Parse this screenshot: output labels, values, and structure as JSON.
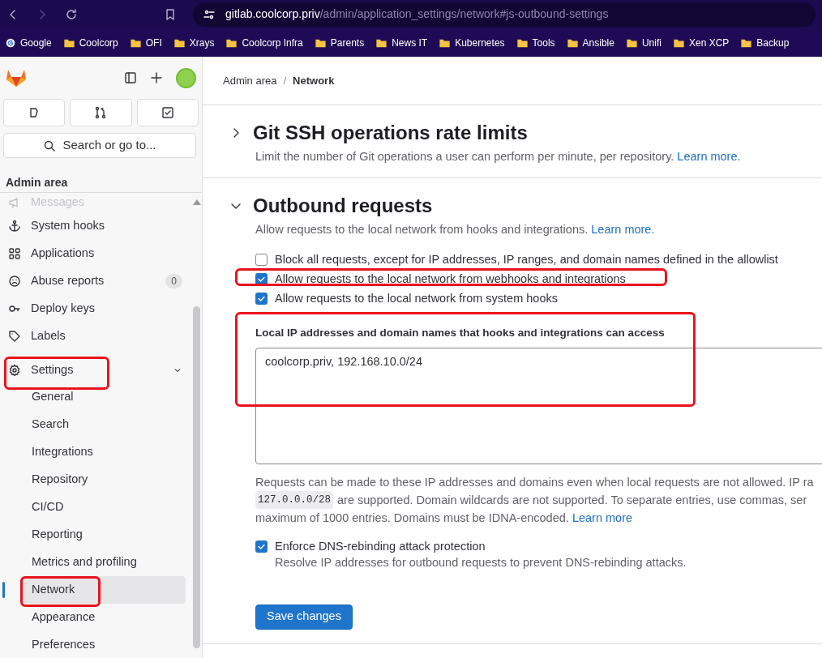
{
  "browser": {
    "url_host": "gitlab.coolcorp.priv",
    "url_path": "/admin/application_settings/network#js-outbound-settings",
    "bookmarks": [
      {
        "label": "Google",
        "kind": "site"
      },
      {
        "label": "Coolcorp",
        "kind": "folder"
      },
      {
        "label": "OFI",
        "kind": "folder"
      },
      {
        "label": "Xrays",
        "kind": "folder"
      },
      {
        "label": "Coolcorp Infra",
        "kind": "folder"
      },
      {
        "label": "Parents",
        "kind": "folder"
      },
      {
        "label": "News IT",
        "kind": "folder"
      },
      {
        "label": "Kubernetes",
        "kind": "folder"
      },
      {
        "label": "Tools",
        "kind": "folder"
      },
      {
        "label": "Ansible",
        "kind": "folder"
      },
      {
        "label": "Unifi",
        "kind": "folder"
      },
      {
        "label": "Xen XCP",
        "kind": "folder"
      },
      {
        "label": "Backup",
        "kind": "folder"
      }
    ]
  },
  "sidebar": {
    "search_placeholder": "Search or go to...",
    "section_title": "Admin area",
    "items": [
      {
        "label": "Messages",
        "faded": true,
        "selected": false
      },
      {
        "label": "System hooks",
        "faded": false,
        "selected": false
      },
      {
        "label": "Applications",
        "faded": false,
        "selected": false
      },
      {
        "label": "Abuse reports",
        "faded": false,
        "selected": false,
        "badge": "0"
      },
      {
        "label": "Deploy keys",
        "faded": false,
        "selected": false
      },
      {
        "label": "Labels",
        "faded": false,
        "selected": false
      },
      {
        "label": "Settings",
        "faded": false,
        "selected": false,
        "expanded": true,
        "children": [
          {
            "label": "General",
            "selected": false
          },
          {
            "label": "Search",
            "selected": false
          },
          {
            "label": "Integrations",
            "selected": false
          },
          {
            "label": "Repository",
            "selected": false
          },
          {
            "label": "CI/CD",
            "selected": false
          },
          {
            "label": "Reporting",
            "selected": false
          },
          {
            "label": "Metrics and profiling",
            "selected": false
          },
          {
            "label": "Network",
            "selected": true
          },
          {
            "label": "Appearance",
            "selected": false
          },
          {
            "label": "Preferences",
            "selected": false
          }
        ]
      }
    ]
  },
  "breadcrumb": [
    "Admin area",
    "Network"
  ],
  "breadcrumb_separator": "/",
  "sections": [
    {
      "title": "Git SSH operations rate limits",
      "expanded": false,
      "description": "Limit the number of Git operations a user can perform per minute, per repository.",
      "link": "Learn more."
    },
    {
      "title": "Outbound requests",
      "expanded": true,
      "description": "Allow requests to the local network from hooks and integrations.",
      "link": "Learn more.",
      "checkboxes": [
        {
          "label": "Block all requests, except for IP addresses, IP ranges, and domain names defined in the allowlist",
          "checked": false
        },
        {
          "label": "Allow requests to the local network from webhooks and integrations",
          "checked": true
        },
        {
          "label": "Allow requests to the local network from system hooks",
          "checked": true
        }
      ],
      "allowlist_label": "Local IP addresses and domain names that hooks and integrations can access",
      "allowlist_value": "coolcorp.priv, 192.168.10.0/24",
      "help_line_1": "Requests can be made to these IP addresses and domains even when local requests are not allowed. IP ra",
      "help_code": "127.0.0.0/28",
      "help_line_2": "are supported. Domain wildcards are not supported. To separate entries, use commas, ser",
      "help_line_3": "maximum of 1000 entries. Domains must be IDNA-encoded.",
      "help_link": "Learn more",
      "dns_checkbox": {
        "label": "Enforce DNS-rebinding attack protection",
        "help": "Resolve IP addresses for outbound requests to prevent DNS-rebinding attacks.",
        "checked": true
      },
      "save_button": "Save changes"
    }
  ]
}
